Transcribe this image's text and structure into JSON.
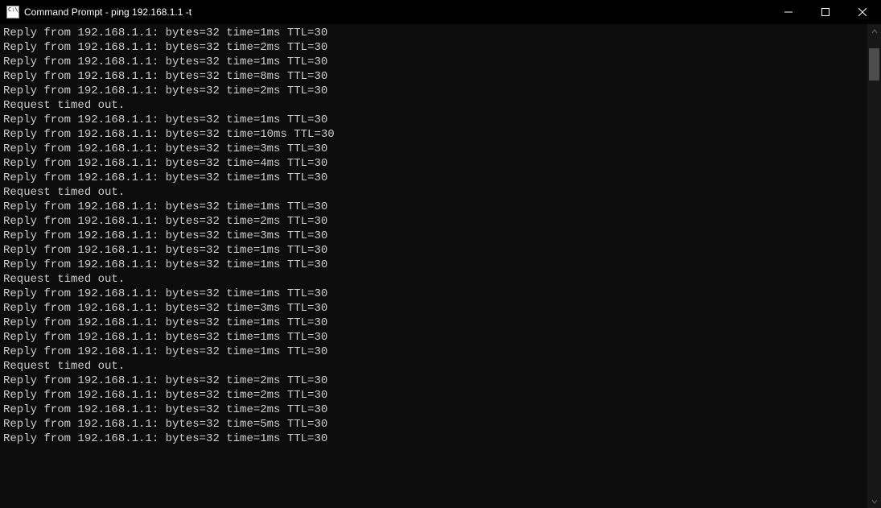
{
  "window": {
    "title": "Command Prompt - ping  192.168.1.1 -t"
  },
  "lines": [
    "Reply from 192.168.1.1: bytes=32 time=1ms TTL=30",
    "Reply from 192.168.1.1: bytes=32 time=2ms TTL=30",
    "Reply from 192.168.1.1: bytes=32 time=1ms TTL=30",
    "Reply from 192.168.1.1: bytes=32 time=8ms TTL=30",
    "Reply from 192.168.1.1: bytes=32 time=2ms TTL=30",
    "Request timed out.",
    "Reply from 192.168.1.1: bytes=32 time=1ms TTL=30",
    "Reply from 192.168.1.1: bytes=32 time=10ms TTL=30",
    "Reply from 192.168.1.1: bytes=32 time=3ms TTL=30",
    "Reply from 192.168.1.1: bytes=32 time=4ms TTL=30",
    "Reply from 192.168.1.1: bytes=32 time=1ms TTL=30",
    "Request timed out.",
    "Reply from 192.168.1.1: bytes=32 time=1ms TTL=30",
    "Reply from 192.168.1.1: bytes=32 time=2ms TTL=30",
    "Reply from 192.168.1.1: bytes=32 time=3ms TTL=30",
    "Reply from 192.168.1.1: bytes=32 time=1ms TTL=30",
    "Reply from 192.168.1.1: bytes=32 time=1ms TTL=30",
    "Request timed out.",
    "Reply from 192.168.1.1: bytes=32 time=1ms TTL=30",
    "Reply from 192.168.1.1: bytes=32 time=3ms TTL=30",
    "Reply from 192.168.1.1: bytes=32 time=1ms TTL=30",
    "Reply from 192.168.1.1: bytes=32 time=1ms TTL=30",
    "Reply from 192.168.1.1: bytes=32 time=1ms TTL=30",
    "Request timed out.",
    "Reply from 192.168.1.1: bytes=32 time=2ms TTL=30",
    "Reply from 192.168.1.1: bytes=32 time=2ms TTL=30",
    "Reply from 192.168.1.1: bytes=32 time=2ms TTL=30",
    "Reply from 192.168.1.1: bytes=32 time=5ms TTL=30",
    "Reply from 192.168.1.1: bytes=32 time=1ms TTL=30"
  ]
}
